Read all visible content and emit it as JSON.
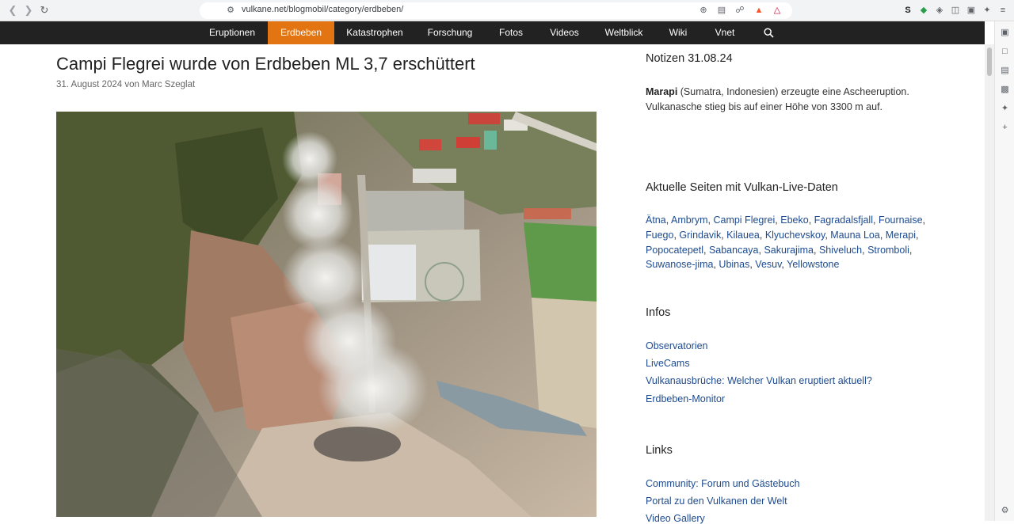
{
  "browser": {
    "url": "vulkane.net/blogmobil/category/erdbeben/"
  },
  "site_nav": {
    "items": [
      "Eruptionen",
      "Erdbeben",
      "Katastrophen",
      "Forschung",
      "Fotos",
      "Videos",
      "Weltblick",
      "Wiki",
      "Vnet"
    ],
    "active": "Erdbeben"
  },
  "article": {
    "title": "Campi Flegrei wurde von Erdbeben ML 3,7 erschüttert",
    "meta": "31. August 2024 von Marc Szeglat"
  },
  "sidebar": {
    "notizen": {
      "title": "Notizen 31.08.24",
      "bold": "Marapi",
      "text": " (Sumatra, Indonesien) erzeugte eine Ascheeruption. Vulkanasche stieg bis auf einer Höhe von 3300 m auf."
    },
    "live": {
      "title": "Aktuelle Seiten mit Vulkan-Live-Daten",
      "links": [
        "Ätna",
        "Ambrym",
        "Campi Flegrei",
        "Ebeko",
        "Fagradalsfjall",
        "Fournaise",
        "Fuego",
        "Grindavik",
        "Kilauea",
        "Klyuchevskoy",
        "Mauna Loa",
        "Merapi",
        "Popocatepetl",
        "Sabancaya",
        "Sakurajima",
        "Shiveluch",
        "Stromboli",
        "Suwanose-jima",
        "Ubinas",
        "Vesuv",
        "Yellowstone"
      ]
    },
    "infos": {
      "title": "Infos",
      "links": [
        "Observatorien",
        "LiveCams",
        "Vulkanausbrüche: Welcher Vulkan eruptiert aktuell?",
        "Erdbeben-Monitor"
      ]
    },
    "links": {
      "title": "Links",
      "links": [
        "Community: Forum und Gästebuch",
        "Portal zu den Vulkanen der Welt",
        "Video Gallery"
      ]
    }
  },
  "colors": {
    "nav_bg": "#222222",
    "nav_active": "#e27412",
    "link": "#1e4b8f"
  }
}
